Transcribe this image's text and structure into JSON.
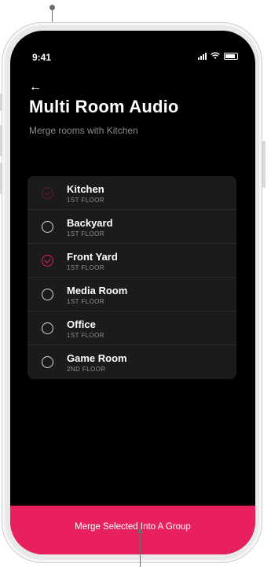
{
  "status_bar": {
    "time": "9:41"
  },
  "header": {
    "title": "Multi Room Audio",
    "subtitle": "Merge rooms with Kitchen",
    "back_icon": "arrow-left-icon"
  },
  "rooms": [
    {
      "name": "Kitchen",
      "floor": "1ST FLOOR",
      "state": "dim-selected"
    },
    {
      "name": "Backyard",
      "floor": "1ST FLOOR",
      "state": "unselected"
    },
    {
      "name": "Front Yard",
      "floor": "1ST FLOOR",
      "state": "selected"
    },
    {
      "name": "Media Room",
      "floor": "1ST FLOOR",
      "state": "unselected"
    },
    {
      "name": "Office",
      "floor": "1ST FLOOR",
      "state": "unselected"
    },
    {
      "name": "Game Room",
      "floor": "2ND FLOOR",
      "state": "unselected"
    }
  ],
  "footer": {
    "merge_label": "Merge Selected Into A Group"
  },
  "colors": {
    "accent": "#e8205e",
    "background": "#000000",
    "card": "#1b1b1b"
  }
}
